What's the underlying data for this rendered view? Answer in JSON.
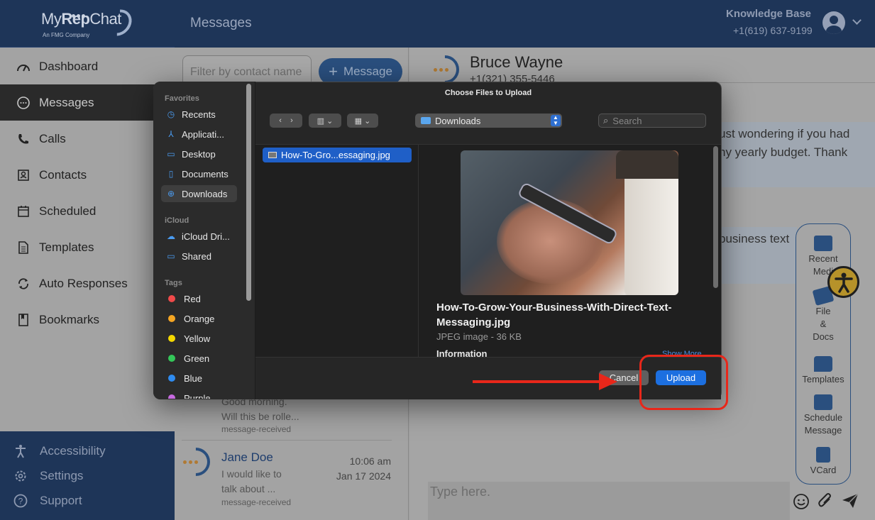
{
  "app": {
    "logo_text_1": "My",
    "logo_text_2": "Rep",
    "logo_text_3": "Chat",
    "logo_sub": "An FMG Company",
    "page_title": "Messages",
    "account_name": "Knowledge Base",
    "account_phone": "+1(619) 637-9199",
    "colors": {
      "navy": "#1e3558",
      "accent": "#2a4f7e",
      "highlight": "#e8271a",
      "upload_blue": "#1c6fe0"
    }
  },
  "sidebar": {
    "items": [
      {
        "label": "Dashboard",
        "icon": "gauge-icon"
      },
      {
        "label": "Messages",
        "icon": "chat-bubble-icon"
      },
      {
        "label": "Calls",
        "icon": "phone-icon"
      },
      {
        "label": "Contacts",
        "icon": "contact-card-icon"
      },
      {
        "label": "Scheduled",
        "icon": "calendar-icon"
      },
      {
        "label": "Templates",
        "icon": "document-icon"
      },
      {
        "label": "Auto Responses",
        "icon": "refresh-icon"
      },
      {
        "label": "Bookmarks",
        "icon": "bookmark-icon"
      }
    ],
    "bottom": [
      {
        "label": "Accessibility",
        "icon": "accessibility-icon"
      },
      {
        "label": "Settings",
        "icon": "gear-icon"
      },
      {
        "label": "Support",
        "icon": "help-icon"
      }
    ]
  },
  "list": {
    "filter_placeholder": "Filter by contact name",
    "new_message_label": "Message",
    "partial_conv": {
      "snippet_1": "Good morning.",
      "snippet_2": "Will this be rolle...",
      "tag": "message-received"
    },
    "conv": {
      "name": "Jane Doe",
      "time": "10:06 am",
      "date": "Jan 17 2024",
      "snippet_1": "I would like to",
      "snippet_2": "talk about ...",
      "tag": "message-received"
    }
  },
  "chat": {
    "contact_name": "Bruce Wayne",
    "contact_phone": "+1(321) 355-5446",
    "bubble1_line1": "ust wondering if you had",
    "bubble1_line2": "ny yearly budget. Thank",
    "bubble2_line1": "business text",
    "compose_placeholder": "Type here.",
    "tools": [
      {
        "line1": "Recent",
        "line2": "Medi",
        "icon": "images-icon"
      },
      {
        "line1": "File",
        "line2": "&",
        "line3": "Docs",
        "icon": "files-icon"
      },
      {
        "line1": "Templates",
        "icon": "template-bubble-icon"
      },
      {
        "line1": "Schedule",
        "line2": "Message",
        "icon": "calendar-icon"
      },
      {
        "line1": "VCard",
        "icon": "vcard-icon"
      }
    ]
  },
  "dialog": {
    "title": "Choose Files to Upload",
    "favorites_header": "Favorites",
    "favorites": [
      "Recents",
      "Applicati...",
      "Desktop",
      "Documents",
      "Downloads"
    ],
    "icloud_header": "iCloud",
    "icloud": [
      "iCloud Dri...",
      "Shared"
    ],
    "tags_header": "Tags",
    "tags": [
      {
        "label": "Red",
        "color": "#f04a4a"
      },
      {
        "label": "Orange",
        "color": "#f5a623"
      },
      {
        "label": "Yellow",
        "color": "#f5d800"
      },
      {
        "label": "Green",
        "color": "#34c759"
      },
      {
        "label": "Blue",
        "color": "#2f8cf0"
      },
      {
        "label": "Purple",
        "color": "#c76ae0"
      }
    ],
    "location": "Downloads",
    "search_placeholder": "Search",
    "selected_file": "How-To-Gro...essaging.jpg",
    "preview_name": "How-To-Grow-Your-Business-With-Direct-Text-Messaging.jpg",
    "preview_info": "JPEG image - 36 KB",
    "information_label": "Information",
    "show_more": "Show More",
    "cancel_label": "Cancel",
    "upload_label": "Upload"
  }
}
